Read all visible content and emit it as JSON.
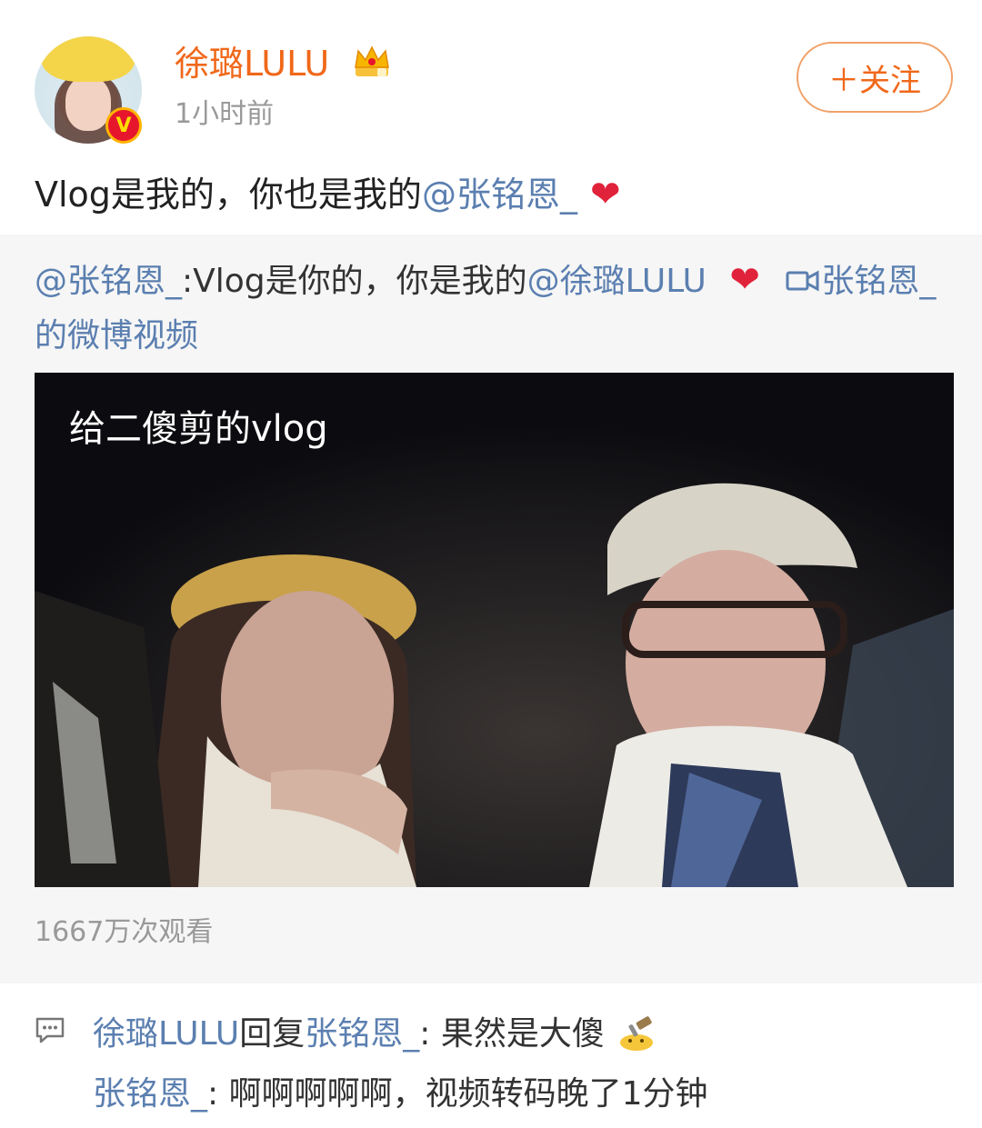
{
  "header": {
    "username": "徐璐LULU",
    "time": "1小时前",
    "follow_label": "＋关注",
    "avatar_badge": "V"
  },
  "post": {
    "text_prefix": "Vlog是我的，你也是我的",
    "mention": "@张铭恩_",
    "heart": "❤"
  },
  "repost": {
    "mention_author": "@张铭恩_",
    "text": ":Vlog是你的，你是我的",
    "mention": "@徐璐LULU",
    "heart": "❤",
    "video_link_icon": "▭◁",
    "video_link_label": "张铭恩_的微博视频",
    "video_caption": "给二傻剪的vlog",
    "views": "1667万次观看"
  },
  "comments": [
    {
      "author": "徐璐LULU",
      "reply_word": "回复",
      "reply_to": "张铭恩_",
      "text": ": 果然是大傻"
    },
    {
      "author": "张铭恩_",
      "text": ": 啊啊啊啊啊，视频转码晚了1分钟"
    }
  ],
  "colors": {
    "username": "#f0681a",
    "link": "#5b7fb0",
    "heart": "#e0223a",
    "muted": "#999999",
    "repost_bg": "#f6f6f6"
  }
}
